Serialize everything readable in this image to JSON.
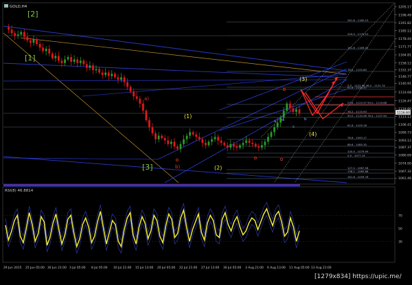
{
  "window": {
    "title": "GOLD,H4",
    "icon": "chart-window-icon"
  },
  "colors": {
    "background": "#000000",
    "candle_bull": "#2a9a2a",
    "candle_bear": "#e01818",
    "axis_text": "#c8c8c8",
    "channel_blue": "#2f3fd8",
    "fib_line": "#7a8aa0",
    "fib_label": "#a9b8d0",
    "wave_yellow": "#f2ea3c",
    "wave_green": "#8bc34a",
    "wave_red": "#e8372a",
    "orange_line": "#d9a334",
    "arrow_red": "#ff2a2a",
    "rsi_line": "#f2ea3c",
    "rsi_band": "#3a4bd8",
    "level_red": "#ff3b3b",
    "dotted_white": "#d0d0d0"
  },
  "chart_data": [
    {
      "type": "candlestick",
      "title": "GOLD,H4",
      "symbol": "GOLD",
      "timeframe": "H4",
      "ylim": [
        1057,
        1208
      ],
      "y_ticks": [
        1205.17,
        1198.49,
        1191.82,
        1185.12,
        1178.44,
        1171.77,
        1164.81,
        1158.12,
        1152.37,
        1146.77,
        1140.91,
        1133.68,
        1126.47,
        1119.8,
        1113.12,
        1106.41,
        1099.73,
        1093.12,
        1087.37,
        1080.69,
        1074.0,
        1067.32,
        1061.46
      ],
      "current_price": 1116.6,
      "x_tick_labels": [
        "29 Jun 2015",
        "25 Jun 05:00",
        "30 Jun 21:00",
        "3 Jul 05:00",
        "8 Jul 05:00",
        "10 Jul 21:00",
        "15 Jul 13:00",
        "20 Jul 05:00",
        "22 Jul 21:00",
        "27 Jul 13:00",
        "30 Jul 05:00",
        "3 Aug 21:00",
        "6 Aug 13:00",
        "11 Aug 05:00",
        "13 Aug 21:00"
      ],
      "price_path": [
        1188,
        1186,
        1183,
        1181,
        1182,
        1184,
        1180,
        1177,
        1175,
        1178,
        1174,
        1171,
        1168,
        1170,
        1166,
        1162,
        1164,
        1160,
        1158,
        1161,
        1163,
        1159,
        1161,
        1158,
        1160,
        1157,
        1154,
        1156,
        1152,
        1153,
        1150,
        1148,
        1150,
        1147,
        1149,
        1146,
        1144,
        1146,
        1142,
        1138,
        1134,
        1130,
        1128,
        1124,
        1118,
        1110,
        1104,
        1099,
        1094,
        1097,
        1095,
        1093,
        1090,
        1092,
        1088,
        1086,
        1090,
        1094,
        1097,
        1100,
        1098,
        1096,
        1094,
        1091,
        1089,
        1092,
        1094,
        1096,
        1093,
        1091,
        1089,
        1087,
        1090,
        1088,
        1087,
        1089,
        1091,
        1093,
        1091,
        1090,
        1088,
        1087,
        1089,
        1092,
        1096,
        1100,
        1104,
        1108,
        1112,
        1118,
        1124,
        1120,
        1117,
        1119,
        1116
      ],
      "rsi": {
        "label": "RSI(8) 46.8814",
        "period": 8,
        "value": 46.8814,
        "ylim": [
          0,
          100
        ],
        "values": [
          55,
          32,
          45,
          62,
          70,
          38,
          28,
          50,
          74,
          56,
          30,
          42,
          68,
          60,
          24,
          36,
          58,
          72,
          48,
          26,
          40,
          64,
          70,
          44,
          22,
          34,
          56,
          66,
          52,
          28,
          38,
          60,
          76,
          50,
          26,
          44,
          62,
          56,
          30,
          22,
          48,
          66,
          74,
          40,
          26,
          52,
          68,
          58,
          34,
          46,
          70,
          62,
          38,
          28,
          54,
          72,
          64,
          36,
          42,
          66,
          78,
          52,
          30,
          48,
          60,
          72,
          44,
          32,
          58,
          70,
          62,
          40,
          36,
          64,
          74,
          56,
          46,
          60,
          68,
          52,
          40,
          46,
          58,
          66,
          62,
          48,
          60,
          72,
          80,
          66,
          54,
          70,
          76,
          60,
          38,
          44,
          66,
          52,
          30,
          46
        ],
        "ticks": [
          30,
          50,
          70
        ]
      }
    }
  ],
  "fibonacci_levels": [
    {
      "label": "261.8 - 1185.23"
    },
    {
      "label": "200.0 - 1175.10"
    },
    {
      "label": "161.8 - 1169.45"
    },
    {
      "label": "78.6 - 1155.80"
    },
    {
      "label": "61.8 - 1146.37"
    },
    {
      "label": "0.0 - 1122.96  38.2 - 1131.74"
    },
    {
      "label": "23.6 - 1123.37  50.0 - 1119.68"
    },
    {
      "label": "38.2 - 1115.93"
    },
    {
      "label": "50.0 - 1110.46  76.4 - 1107.94"
    },
    {
      "label": "61.8 - 1105.18"
    },
    {
      "label": "78.6 - 1093.17"
    },
    {
      "label": "88.6 - 1085.30"
    },
    {
      "label": "100.0 - 1079.99"
    },
    {
      "label": "0.0 - 1077.19"
    },
    {
      "label": "127.2 - 1067.58"
    },
    {
      "label": "138.2 - 1065.88"
    },
    {
      "label": "161.8 - 1059.76"
    }
  ],
  "wave_labels": [
    {
      "text": "[2]",
      "color": "wave_green"
    },
    {
      "text": "[1]",
      "color": "wave_green"
    },
    {
      "text": "[3]",
      "color": "wave_green"
    },
    {
      "text": "a)",
      "color": "wave_red"
    },
    {
      "text": "b)",
      "color": "wave_red"
    },
    {
      "text": "(1)",
      "color": "wave_yellow"
    },
    {
      "text": "(2)",
      "color": "wave_yellow"
    },
    {
      "text": "(3)",
      "color": "wave_yellow"
    },
    {
      "text": "(4)",
      "color": "wave_yellow"
    },
    {
      "text": "b",
      "color": "wave_blue"
    },
    {
      "text": "c",
      "color": "wave_blue"
    },
    {
      "text": "d",
      "color": "wave_blue"
    },
    {
      "text": "a",
      "color": "wave_blue"
    }
  ],
  "watermark": "[1279x834] https://upic.me/"
}
